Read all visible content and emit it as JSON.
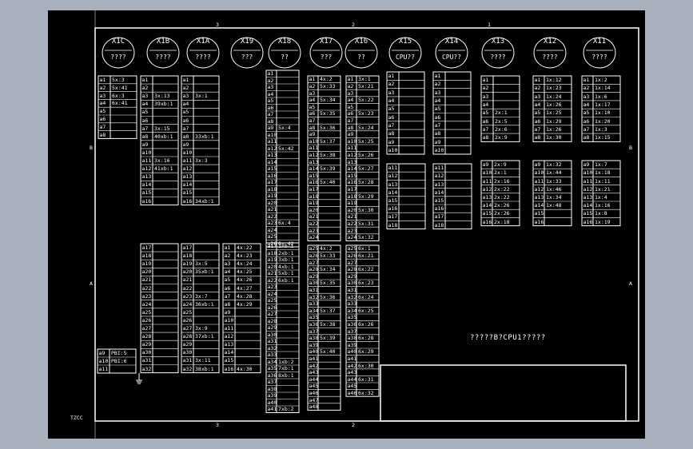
{
  "sheet": {
    "corner_label": "TZCC",
    "frame_letters": [
      "B",
      "A"
    ],
    "frame_numbers": [
      "3",
      "2",
      "1"
    ]
  },
  "note": "?????B?CPU1?????",
  "colors": {
    "background": "#a9b0bd",
    "sheet": "#000000",
    "line": "#ffffff"
  },
  "connectors": [
    {
      "name": "X1C",
      "sub": "????"
    },
    {
      "name": "X1B",
      "sub": "????"
    },
    {
      "name": "X1A",
      "sub": "????"
    },
    {
      "name": "X19",
      "sub": "???"
    },
    {
      "name": "X18",
      "sub": "??"
    },
    {
      "name": "X17",
      "sub": "???"
    },
    {
      "name": "X16",
      "sub": "??"
    },
    {
      "name": "X15",
      "sub": "CPU??"
    },
    {
      "name": "X14",
      "sub": "CPU??"
    },
    {
      "name": "X13",
      "sub": "????"
    },
    {
      "name": "X12",
      "sub": "????"
    },
    {
      "name": "X11",
      "sub": "????"
    }
  ],
  "tables": [
    {
      "cells": [
        [
          "a1",
          "5x:3"
        ],
        [
          "a2",
          "5x:41"
        ],
        [
          "a3",
          "6x:3"
        ],
        [
          "a4",
          "6x:41"
        ],
        [
          "a5",
          ""
        ],
        [
          "a6",
          ""
        ],
        [
          "a7",
          ""
        ],
        [
          "a8",
          ""
        ]
      ]
    },
    {
      "cells": [
        [
          "a1",
          ""
        ],
        [
          "a2",
          ""
        ],
        [
          "a3",
          "3x:13"
        ],
        [
          "a4",
          "39xb:1"
        ],
        [
          "a5",
          ""
        ],
        [
          "a6",
          ""
        ],
        [
          "a7",
          "3x:15"
        ],
        [
          "a8",
          "40xb:1"
        ],
        [
          "a9",
          ""
        ],
        [
          "a10",
          ""
        ],
        [
          "a11",
          "3x:16"
        ],
        [
          "a12",
          "41xb:1"
        ],
        [
          "a13",
          ""
        ],
        [
          "a14",
          ""
        ],
        [
          "a15",
          ""
        ],
        [
          "a16",
          ""
        ]
      ]
    },
    {
      "cells": [
        [
          "a1",
          ""
        ],
        [
          "a2",
          ""
        ],
        [
          "a3",
          "3x:1"
        ],
        [
          "a4",
          ""
        ],
        [
          "a5",
          ""
        ],
        [
          "a6",
          ""
        ],
        [
          "a7",
          ""
        ],
        [
          "a8",
          "33xb:1"
        ],
        [
          "a9",
          ""
        ],
        [
          "a10",
          ""
        ],
        [
          "a11",
          "3x:3"
        ],
        [
          "a12",
          ""
        ],
        [
          "a13",
          ""
        ],
        [
          "a14",
          ""
        ],
        [
          "a15",
          ""
        ],
        [
          "a16",
          "34xb:1"
        ]
      ]
    },
    {
      "cells": [
        [
          "a1",
          ""
        ],
        [
          "a2",
          ""
        ],
        [
          "a3",
          ""
        ],
        [
          "a4",
          ""
        ],
        [
          "a5",
          ""
        ],
        [
          "a6",
          ""
        ],
        [
          "a7",
          ""
        ],
        [
          "a8",
          ""
        ],
        [
          "a9",
          "5x:4"
        ],
        [
          "a10",
          ""
        ],
        [
          "a11",
          ""
        ],
        [
          "a12",
          "5x:42"
        ],
        [
          "a13",
          ""
        ],
        [
          "a14",
          ""
        ],
        [
          "a15",
          ""
        ],
        [
          "a16",
          ""
        ],
        [
          "a17",
          ""
        ],
        [
          "a18",
          ""
        ],
        [
          "a19",
          ""
        ],
        [
          "a20",
          ""
        ],
        [
          "a21",
          ""
        ],
        [
          "a22",
          ""
        ],
        [
          "a23",
          "6x:4"
        ],
        [
          "a24",
          ""
        ],
        [
          "a25",
          ""
        ],
        [
          "a26",
          "6x:42"
        ]
      ]
    },
    {
      "cells": [
        [
          "a1",
          "4x:2"
        ],
        [
          "a2",
          "5x:33"
        ],
        [
          "a3",
          ""
        ],
        [
          "a4",
          "5x:34"
        ],
        [
          "a5",
          ""
        ],
        [
          "a6",
          "5x:35"
        ],
        [
          "a7",
          ""
        ],
        [
          "a8",
          "5x:36"
        ],
        [
          "a9",
          ""
        ],
        [
          "a10",
          "5x:37"
        ],
        [
          "a11",
          ""
        ],
        [
          "a12",
          "5x:38"
        ],
        [
          "a13",
          ""
        ],
        [
          "a14",
          "5x:39"
        ],
        [
          "a15",
          ""
        ],
        [
          "a16",
          "5x:40"
        ],
        [
          "a17",
          ""
        ],
        [
          "a18",
          ""
        ],
        [
          "a19",
          ""
        ],
        [
          "a20",
          ""
        ],
        [
          "a21",
          ""
        ],
        [
          "a22",
          ""
        ],
        [
          "a23",
          ""
        ],
        [
          "a24",
          ""
        ]
      ]
    },
    {
      "cells": [
        [
          "a1",
          "3x:1"
        ],
        [
          "a2",
          "5x:21"
        ],
        [
          "a3",
          ""
        ],
        [
          "a4",
          "5x:22"
        ],
        [
          "a5",
          ""
        ],
        [
          "a6",
          "5x:23"
        ],
        [
          "a7",
          ""
        ],
        [
          "a8",
          "5x:24"
        ],
        [
          "a9",
          ""
        ],
        [
          "a10",
          "5x:25"
        ],
        [
          "a11",
          ""
        ],
        [
          "a12",
          "5x:26"
        ],
        [
          "a13",
          ""
        ],
        [
          "a14",
          "5x:27"
        ],
        [
          "a15",
          ""
        ],
        [
          "a16",
          "5x:28"
        ],
        [
          "a17",
          ""
        ],
        [
          "a18",
          "5x:29"
        ],
        [
          "a19",
          ""
        ],
        [
          "a20",
          "5x:30"
        ],
        [
          "a21",
          ""
        ],
        [
          "a22",
          "5x:31"
        ],
        [
          "a23",
          ""
        ],
        [
          "a24",
          "5x:32"
        ]
      ]
    },
    {
      "cells": [
        [
          "a1",
          ""
        ],
        [
          "a2",
          ""
        ],
        [
          "a3",
          ""
        ],
        [
          "a4",
          ""
        ],
        [
          "a5",
          ""
        ],
        [
          "a6",
          ""
        ],
        [
          "a7",
          ""
        ],
        [
          "a8",
          ""
        ],
        [
          "a9",
          ""
        ],
        [
          "a10",
          ""
        ]
      ]
    },
    {
      "cells": [
        [
          "a1",
          ""
        ],
        [
          "a2",
          ""
        ],
        [
          "a3",
          ""
        ],
        [
          "a4",
          ""
        ],
        [
          "a5",
          ""
        ],
        [
          "a6",
          ""
        ],
        [
          "a7",
          ""
        ],
        [
          "a8",
          ""
        ],
        [
          "a9",
          ""
        ],
        [
          "a10",
          ""
        ]
      ]
    },
    {
      "cells": [
        [
          "a1",
          ""
        ],
        [
          "a2",
          ""
        ],
        [
          "a3",
          ""
        ],
        [
          "a4",
          ""
        ],
        [
          "a5",
          "2x:1"
        ],
        [
          "a6",
          "2x:5"
        ],
        [
          "a7",
          "2x:6"
        ],
        [
          "a8",
          "2x:9"
        ]
      ]
    },
    {
      "cells": [
        [
          "a1",
          "1x:12"
        ],
        [
          "a2",
          "1x:23"
        ],
        [
          "a3",
          "1x:24"
        ],
        [
          "a4",
          "1x:26"
        ],
        [
          "a5",
          "1x:25"
        ],
        [
          "a6",
          "1x:29"
        ],
        [
          "a7",
          "1x:26"
        ],
        [
          "a8",
          "1x:30"
        ]
      ]
    },
    {
      "cells": [
        [
          "a1",
          "1x:2"
        ],
        [
          "a2",
          "1x:14"
        ],
        [
          "a3",
          "1x:6"
        ],
        [
          "a4",
          "1x:17"
        ],
        [
          "a5",
          "1x:10"
        ],
        [
          "a6",
          "1x:20"
        ],
        [
          "a7",
          "1x:3"
        ],
        [
          "a8",
          "1x:15"
        ]
      ]
    },
    {
      "cells": [
        [
          "a11",
          ""
        ],
        [
          "a12",
          ""
        ],
        [
          "a13",
          ""
        ],
        [
          "a14",
          ""
        ],
        [
          "a15",
          ""
        ],
        [
          "a16",
          ""
        ],
        [
          "a17",
          ""
        ],
        [
          "a18",
          ""
        ]
      ]
    },
    {
      "cells": [
        [
          "a11",
          ""
        ],
        [
          "a12",
          ""
        ],
        [
          "a13",
          ""
        ],
        [
          "a14",
          ""
        ],
        [
          "a15",
          ""
        ],
        [
          "a16",
          ""
        ],
        [
          "a17",
          ""
        ],
        [
          "a18",
          ""
        ]
      ]
    },
    {
      "cells": [
        [
          "a9",
          "2x:9"
        ],
        [
          "a10",
          "2x:1"
        ],
        [
          "a11",
          "2x:16"
        ],
        [
          "a12",
          "2x:22"
        ],
        [
          "a13",
          "2x:22"
        ],
        [
          "a14",
          "2x:26"
        ],
        [
          "a15",
          "2x:26"
        ],
        [
          "a16",
          "2x:18"
        ]
      ]
    },
    {
      "cells": [
        [
          "a9",
          "1x:32"
        ],
        [
          "a10",
          "1x:44"
        ],
        [
          "a11",
          "1x:33"
        ],
        [
          "a12",
          "1x:46"
        ],
        [
          "a13",
          "1x:34"
        ],
        [
          "a14",
          "1x:48"
        ],
        [
          "a15",
          ""
        ],
        [
          "a16",
          ""
        ]
      ]
    },
    {
      "cells": [
        [
          "a9",
          "1x:7"
        ],
        [
          "a10",
          "1x:18"
        ],
        [
          "a11",
          "1x:11"
        ],
        [
          "a12",
          "1x:21"
        ],
        [
          "a13",
          "1x:4"
        ],
        [
          "a14",
          "1x:16"
        ],
        [
          "a15",
          "1x:8"
        ],
        [
          "a16",
          "1x:19"
        ]
      ]
    },
    {
      "cells": [
        [
          "a9",
          "PBI:5"
        ],
        [
          "a10",
          "PBI:6"
        ],
        [
          "a11",
          ""
        ]
      ]
    },
    {
      "cells": [
        [
          "a17",
          ""
        ],
        [
          "a18",
          ""
        ],
        [
          "a19",
          ""
        ],
        [
          "a20",
          ""
        ],
        [
          "a21",
          ""
        ],
        [
          "a22",
          ""
        ],
        [
          "a23",
          ""
        ],
        [
          "a24",
          ""
        ],
        [
          "a25",
          ""
        ],
        [
          "a26",
          ""
        ],
        [
          "a27",
          ""
        ],
        [
          "a28",
          ""
        ],
        [
          "a29",
          ""
        ],
        [
          "a30",
          ""
        ],
        [
          "a31",
          ""
        ],
        [
          "a32",
          ""
        ]
      ]
    },
    {
      "cells": [
        [
          "a17",
          ""
        ],
        [
          "a18",
          ""
        ],
        [
          "a19",
          "3x:5"
        ],
        [
          "a20",
          "35xb:1"
        ],
        [
          "a21",
          ""
        ],
        [
          "a22",
          ""
        ],
        [
          "a23",
          "3x:7"
        ],
        [
          "a24",
          "36xb:1"
        ],
        [
          "a25",
          ""
        ],
        [
          "a26",
          ""
        ],
        [
          "a27",
          "3x:9"
        ],
        [
          "a28",
          "37xb:1"
        ],
        [
          "a29",
          ""
        ],
        [
          "a30",
          ""
        ],
        [
          "a31",
          "3x:11"
        ],
        [
          "a32",
          "38xb:1"
        ]
      ]
    },
    {
      "cells": [
        [
          "a1",
          "4x:22"
        ],
        [
          "a2",
          "4x:23"
        ],
        [
          "a3",
          "4x:24"
        ],
        [
          "a4",
          "4x:25"
        ],
        [
          "a5",
          "4x:26"
        ],
        [
          "a6",
          "4x:27"
        ],
        [
          "a7",
          "4x:28"
        ],
        [
          "a8",
          "4x:29"
        ],
        [
          "a9",
          ""
        ],
        [
          "a10",
          ""
        ],
        [
          "a11",
          ""
        ],
        [
          "a12",
          ""
        ],
        [
          "a13",
          ""
        ],
        [
          "a14",
          ""
        ],
        [
          "a15",
          ""
        ],
        [
          "a16",
          "4x:30"
        ]
      ]
    },
    {
      "cells": [
        [
          "a17",
          "1xb:1"
        ],
        [
          "a18",
          "2xb:1"
        ],
        [
          "a19",
          "3xb:1"
        ],
        [
          "a20",
          "4xb:1"
        ],
        [
          "a21",
          "5xb:1"
        ],
        [
          "a22",
          "6xb:1"
        ],
        [
          "a23",
          ""
        ],
        [
          "a24",
          ""
        ],
        [
          "a25",
          ""
        ],
        [
          "a26",
          ""
        ],
        [
          "a27",
          ""
        ],
        [
          "a28",
          ""
        ],
        [
          "a29",
          ""
        ],
        [
          "a30",
          ""
        ],
        [
          "a31",
          ""
        ],
        [
          "a32",
          ""
        ],
        [
          "a33",
          ""
        ],
        [
          "a34",
          "1xb:2"
        ],
        [
          "a35",
          "7xb:1"
        ],
        [
          "a36",
          "8xb:1"
        ],
        [
          "a37",
          ""
        ],
        [
          "a38",
          ""
        ],
        [
          "a39",
          ""
        ],
        [
          "a40",
          ""
        ],
        [
          "a41",
          "7xb:2"
        ]
      ]
    },
    {
      "cells": [
        [
          "a25",
          "4x:2"
        ],
        [
          "a26",
          "5x:33"
        ],
        [
          "a27",
          ""
        ],
        [
          "a28",
          "5x:34"
        ],
        [
          "a29",
          ""
        ],
        [
          "a30",
          "5x:35"
        ],
        [
          "a31",
          ""
        ],
        [
          "a32",
          "5x:36"
        ],
        [
          "a33",
          ""
        ],
        [
          "a34",
          "5x:37"
        ],
        [
          "a35",
          ""
        ],
        [
          "a36",
          "5x:38"
        ],
        [
          "a37",
          ""
        ],
        [
          "a38",
          "5x:39"
        ],
        [
          "a39",
          ""
        ],
        [
          "a40",
          "5x:40"
        ],
        [
          "a41",
          ""
        ],
        [
          "a42",
          ""
        ],
        [
          "a43",
          ""
        ],
        [
          "a44",
          ""
        ],
        [
          "a45",
          ""
        ],
        [
          "a46",
          ""
        ],
        [
          "a47",
          ""
        ],
        [
          "a48",
          ""
        ]
      ]
    },
    {
      "cells": [
        [
          "a25",
          "6x:1"
        ],
        [
          "a26",
          "6x:21"
        ],
        [
          "a27",
          ""
        ],
        [
          "a28",
          "6x:22"
        ],
        [
          "a29",
          ""
        ],
        [
          "a30",
          "6x:23"
        ],
        [
          "a31",
          ""
        ],
        [
          "a32",
          "6x:24"
        ],
        [
          "a33",
          ""
        ],
        [
          "a34",
          "6x:25"
        ],
        [
          "a35",
          ""
        ],
        [
          "a36",
          "6x:26"
        ],
        [
          "a37",
          ""
        ],
        [
          "a38",
          "6x:28"
        ],
        [
          "a39",
          ""
        ],
        [
          "a40",
          "6x:29"
        ],
        [
          "a41",
          ""
        ],
        [
          "a42",
          "6x:30"
        ],
        [
          "a43",
          ""
        ],
        [
          "a44",
          "6x:31"
        ],
        [
          "a45",
          ""
        ],
        [
          "a46",
          "6x:32"
        ]
      ]
    }
  ]
}
